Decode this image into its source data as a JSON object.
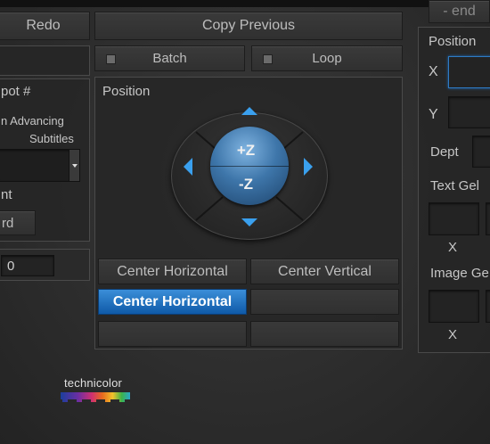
{
  "toolbar": {
    "redo_label": "Redo",
    "copy_previous_label": "Copy Previous",
    "end_label": "- end"
  },
  "left_panel": {
    "spot_label": "pot #",
    "advancing_line1": "n Advancing",
    "advancing_line2": "Subtitles",
    "nt_label": "nt",
    "rd_button_label": "rd",
    "value_field": "0"
  },
  "toggles": {
    "batch_label": "Batch",
    "loop_label": "Loop"
  },
  "position_panel": {
    "title": "Position",
    "plus_z": "+Z",
    "minus_z": "-Z",
    "center_horizontal_1": "Center Horizontal",
    "center_vertical": "Center Vertical",
    "center_horizontal_2": "Center Horizontal"
  },
  "right_panel": {
    "position_label": "Position",
    "x_label": "X",
    "y_label": "Y",
    "depth_label": "Dept",
    "text_geom_label": "Text Gel",
    "text_x_label": "X",
    "image_geom_label": "Image Ge",
    "image_x_label": "X"
  },
  "branding": {
    "logo_text": "technicolor",
    "accent_color": "#1f6fc0"
  }
}
